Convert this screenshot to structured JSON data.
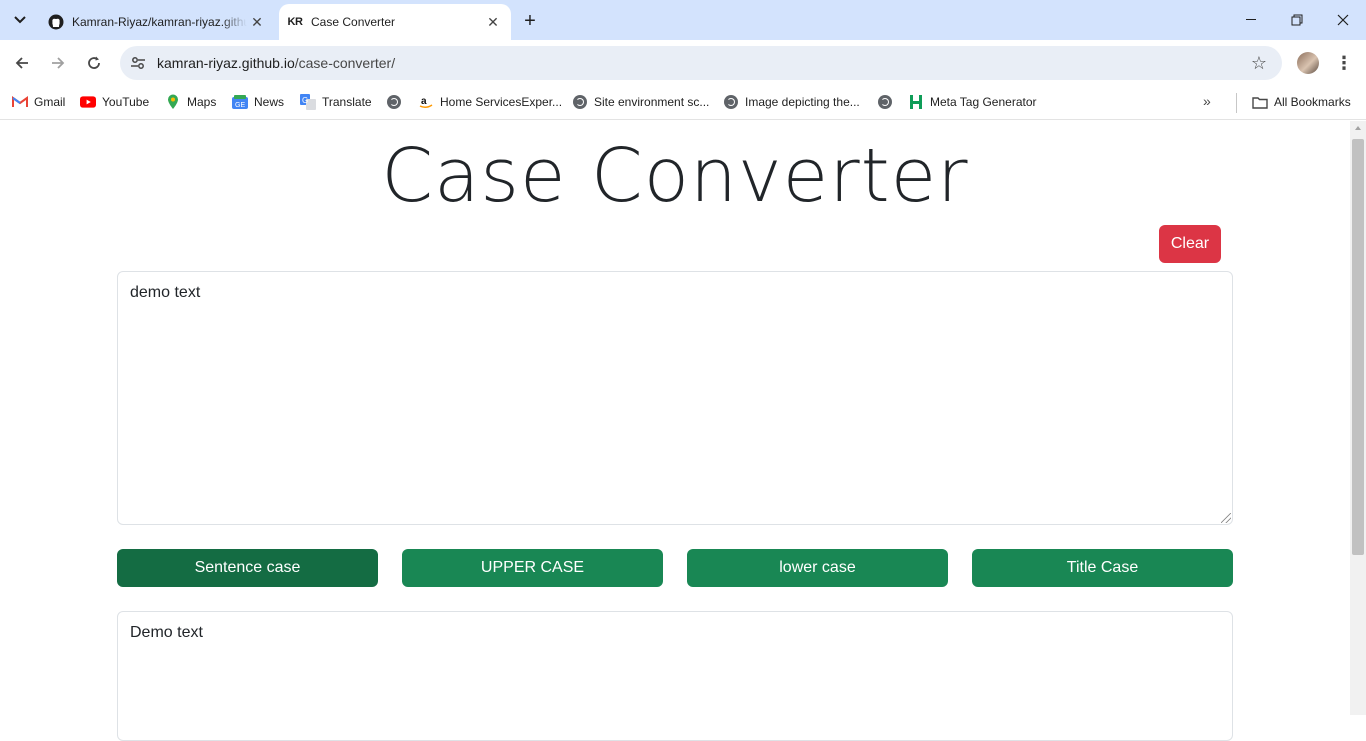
{
  "browser": {
    "tabs": [
      {
        "title": "Kamran-Riyaz/kamran-riyaz.github.io",
        "favicon": "github-icon",
        "active": false
      },
      {
        "title": "Case Converter",
        "favicon_text": "KR",
        "active": true
      }
    ],
    "url": {
      "host": "kamran-riyaz.github.io",
      "path": "/case-converter/"
    },
    "bookmarks": [
      {
        "label": "Gmail",
        "icon": "gmail-icon"
      },
      {
        "label": "YouTube",
        "icon": "youtube-icon"
      },
      {
        "label": "Maps",
        "icon": "maps-icon"
      },
      {
        "label": "News",
        "icon": "news-icon"
      },
      {
        "label": "Translate",
        "icon": "translate-icon"
      },
      {
        "label": "",
        "icon": "globe-icon"
      },
      {
        "label": "Home ServicesExper...",
        "icon": "amazon-icon"
      },
      {
        "label": "Site environment sc...",
        "icon": "globe-icon"
      },
      {
        "label": "Image depicting the...",
        "icon": "globe-icon"
      },
      {
        "label": "",
        "icon": "globe-icon"
      },
      {
        "label": "Meta Tag Generator",
        "icon": "h-logo-icon"
      }
    ],
    "all_bookmarks_label": "All Bookmarks"
  },
  "page": {
    "title": "Case Converter",
    "clear_label": "Clear",
    "input_text": "demo text",
    "output_text": "Demo text",
    "buttons": {
      "sentence": "Sentence case",
      "upper": "UPPER CASE",
      "lower": "lower case",
      "title": "Title Case"
    }
  },
  "colors": {
    "clear": "#dc3545",
    "convert": "#198754",
    "convert_pressed": "#146c43",
    "tabstrip": "#d3e3fd"
  }
}
